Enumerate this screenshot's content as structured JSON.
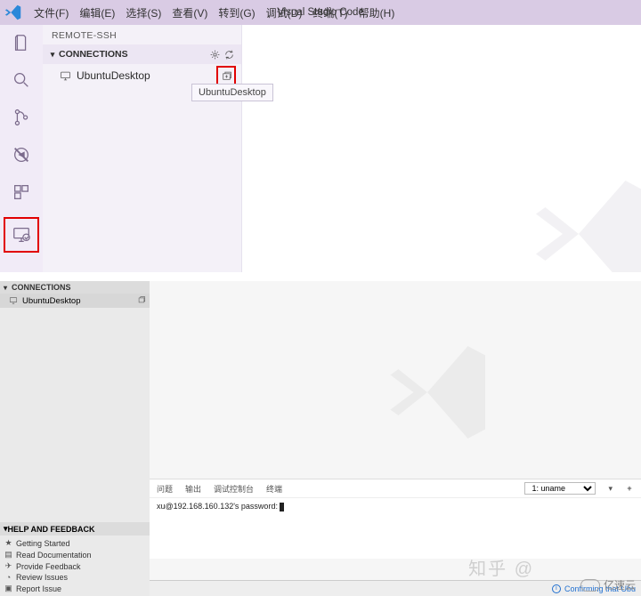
{
  "app_title": "Visual Studio Code",
  "menu": [
    "文件(F)",
    "编辑(E)",
    "选择(S)",
    "查看(V)",
    "转到(G)",
    "调试(D)",
    "终端(T)",
    "帮助(H)"
  ],
  "panel_title": "REMOTE-SSH",
  "connections": {
    "header": "CONNECTIONS",
    "item": "UbuntuDesktop",
    "tooltip": "UbuntuDesktop"
  },
  "bottom": {
    "connections_hdr": "CONNECTIONS",
    "conn_item": "UbuntuDesktop",
    "help_hdr": "HELP AND FEEDBACK",
    "help_items": [
      "Getting Started",
      "Read Documentation",
      "Provide Feedback",
      "Review Issues",
      "Report Issue"
    ],
    "term_tabs": [
      "问题",
      "输出",
      "调试控制台",
      "终端"
    ],
    "term_selector": "1: uname",
    "term_line": "xu@192.168.160.132's password: ",
    "status_msg": "Confirming that Ubu"
  },
  "watermarks": {
    "zhihu": "知乎 @",
    "yisuyun": "亿速云"
  }
}
